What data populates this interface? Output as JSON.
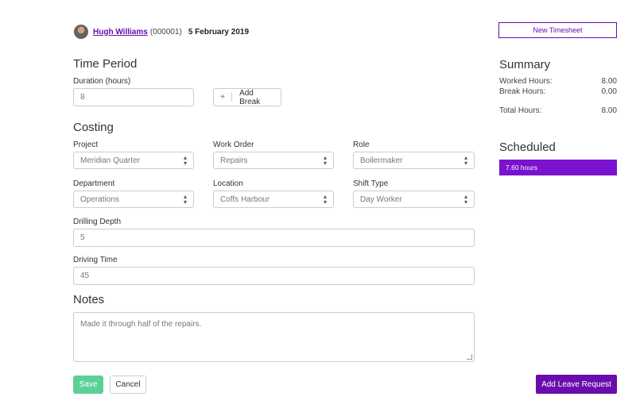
{
  "header": {
    "user_name": "Hugh Williams",
    "user_id": "(000001)",
    "date": "5 February 2019"
  },
  "time_period": {
    "heading": "Time Period",
    "duration_label": "Duration (hours)",
    "duration_value": "8",
    "add_break_label": "Add Break",
    "plus_glyph": "+"
  },
  "costing": {
    "heading": "Costing",
    "fields": [
      {
        "label": "Project",
        "value": "Meridian Quarter"
      },
      {
        "label": "Work Order",
        "value": "Repairs"
      },
      {
        "label": "Role",
        "value": "Boilermaker"
      },
      {
        "label": "Department",
        "value": "Operations"
      },
      {
        "label": "Location",
        "value": "Coffs Harbour"
      },
      {
        "label": "Shift Type",
        "value": "Day Worker"
      }
    ],
    "drilling_depth_label": "Drilling Depth",
    "drilling_depth_value": "5",
    "driving_time_label": "Driving Time",
    "driving_time_value": "45"
  },
  "notes": {
    "heading": "Notes",
    "value": "Made it through half of the repairs."
  },
  "actions": {
    "save_label": "Save",
    "cancel_label": "Cancel",
    "new_timesheet_label": "New Timesheet",
    "add_leave_label": "Add Leave Request"
  },
  "summary": {
    "heading": "Summary",
    "worked_label": "Worked Hours:",
    "worked_value": "8.00",
    "break_label": "Break Hours:",
    "break_value": "0.00",
    "total_label": "Total Hours:",
    "total_value": "8.00"
  },
  "scheduled": {
    "heading": "Scheduled",
    "bar_label": "7.60 hours"
  },
  "colors": {
    "accent_purple": "#6a0dad",
    "save_green": "#5dcf98"
  }
}
